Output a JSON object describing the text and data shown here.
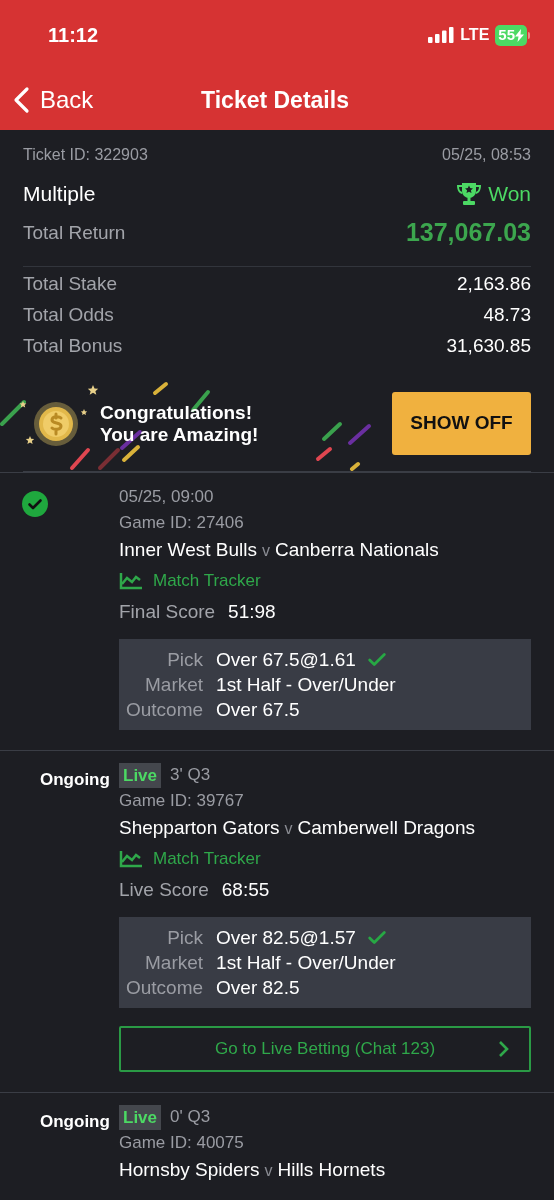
{
  "status_bar": {
    "time": "11:12",
    "network": "LTE",
    "battery": "55"
  },
  "nav": {
    "back": "Back",
    "title": "Ticket Details"
  },
  "ticket": {
    "id": "Ticket ID: 322903",
    "date": "05/25, 08:53",
    "type": "Multiple",
    "result": "Won",
    "return_label": "Total Return",
    "return_value": "137,067.03",
    "totals": [
      {
        "label": "Total Stake",
        "value": "2,163.86"
      },
      {
        "label": "Total Odds",
        "value": "48.73"
      },
      {
        "label": "Total Bonus",
        "value": "31,630.85"
      }
    ]
  },
  "banner": {
    "line1": "Congratulations!",
    "line2": "You are Amazing!",
    "button": "SHOW OFF"
  },
  "legs": [
    {
      "status": {
        "kind": "won"
      },
      "time": "05/25, 09:00",
      "game_id": "Game ID: 27406",
      "home": "Inner West Bulls",
      "sep": "v",
      "away": "Canberra Nationals",
      "tracker": "Match Tracker",
      "score_label": "Final Score",
      "score": "51:98",
      "pick": {
        "rows": [
          {
            "label": "Pick",
            "value": "Over 67.5@1.61",
            "checked": true
          },
          {
            "label": "Market",
            "value": "1st Half - Over/Under",
            "checked": false
          },
          {
            "label": "Outcome",
            "value": "Over 67.5",
            "checked": false
          }
        ]
      }
    },
    {
      "status": {
        "kind": "ongoing",
        "label": "Ongoing"
      },
      "live": "Live",
      "time": "3' Q3",
      "game_id": "Game ID: 39767",
      "home": "Shepparton Gators",
      "sep": "v",
      "away": "Camberwell Dragons",
      "tracker": "Match Tracker",
      "score_label": "Live Score",
      "score": "68:55",
      "pick": {
        "rows": [
          {
            "label": "Pick",
            "value": "Over 82.5@1.57",
            "checked": true
          },
          {
            "label": "Market",
            "value": "1st Half - Over/Under",
            "checked": false
          },
          {
            "label": "Outcome",
            "value": "Over 82.5",
            "checked": false
          }
        ]
      },
      "live_button": "Go to Live Betting (Chat 123)"
    },
    {
      "status": {
        "kind": "ongoing",
        "label": "Ongoing"
      },
      "live": "Live",
      "time": "0' Q3",
      "game_id": "Game ID: 40075",
      "home": "Hornsby Spiders",
      "sep": "v",
      "away": "Hills Hornets"
    }
  ]
}
